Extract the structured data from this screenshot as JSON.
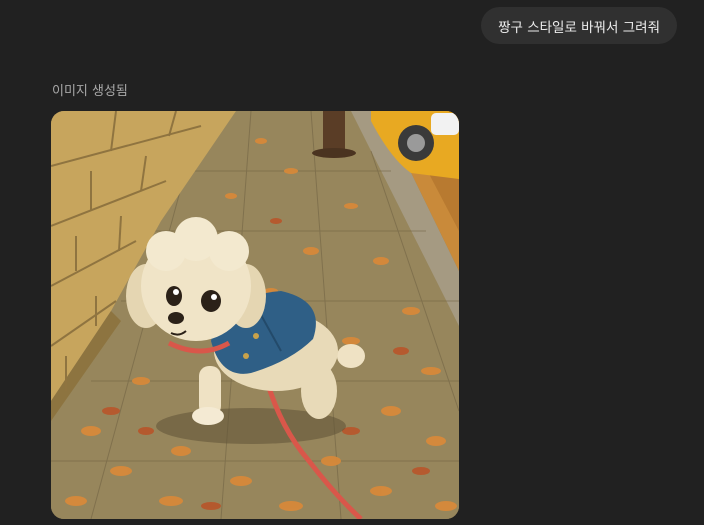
{
  "conversation": {
    "user_message": "짱구 스타일로 바꿔서 그려줘",
    "image_status_label": "이미지 생성됨"
  },
  "generated_image": {
    "subject": "cartoon-poodle-in-denim-jacket-on-autumn-sidewalk",
    "colors": {
      "background": "#212121",
      "bubble": "#303030",
      "wall": "#c9a960",
      "pavement": "#8a7a55",
      "leaf": "#d7893a",
      "jacket": "#2f5f86",
      "leash": "#d9574a",
      "car": "#e8a922"
    }
  }
}
